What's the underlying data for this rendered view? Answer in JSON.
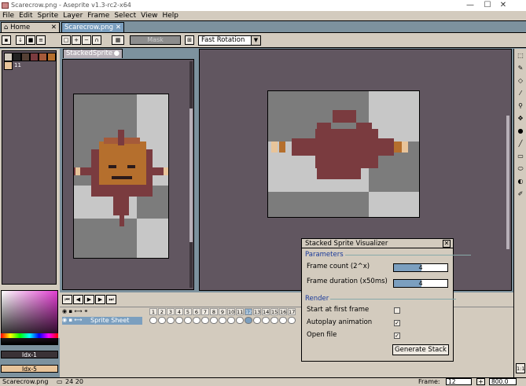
{
  "window": {
    "title": "Scarecrow.png - Aseprite v1.3-rc2-x64",
    "minimize": "—",
    "maximize": "☐",
    "close": "✕"
  },
  "menu": [
    "File",
    "Edit",
    "Sprite",
    "Layer",
    "Frame",
    "Select",
    "View",
    "Help"
  ],
  "tabs": [
    {
      "label": "Home",
      "close": "✕"
    },
    {
      "label": "Scarecrow.png",
      "close": "✕"
    }
  ],
  "toolbar": {
    "mask_label": "Mask",
    "rotation_value": "Fast Rotation",
    "rotation_arrow": "▼"
  },
  "palette": {
    "colors": [
      "#222222",
      "#554035",
      "#7a3b3f",
      "#a55a3a",
      "#b56f2d",
      "#e8c49a"
    ],
    "extra_label": "11"
  },
  "color_picker": {
    "fg_index": "Idx-1",
    "bg_index": "Idx-5"
  },
  "stacked_panel": {
    "label": "StackedSprite",
    "close": "●"
  },
  "timeline": {
    "nav": [
      "⏮",
      "◀",
      "▶",
      "▶",
      "⏭"
    ],
    "layer_name": "Sprite Sheet",
    "frames": [
      "1",
      "2",
      "3",
      "4",
      "5",
      "6",
      "7",
      "8",
      "9",
      "10",
      "11",
      "12",
      "13",
      "14",
      "15",
      "16",
      "17"
    ],
    "active_frame": "12"
  },
  "dialog": {
    "title": "Stacked Sprite Visualizer",
    "close": "✕",
    "params_section": "Parameters",
    "frame_count_label": "Frame count (2^x)",
    "frame_count_value": "4",
    "frame_count_fraction": 0.52,
    "frame_duration_label": "Frame duration (x50ms)",
    "frame_duration_value": "4",
    "frame_duration_fraction": 0.52,
    "render_section": "Render",
    "start_first_label": "Start at first frame",
    "start_first_checked": "",
    "autoplay_label": "Autoplay animation",
    "autoplay_checked": "✓",
    "open_file_label": "Open file",
    "open_file_checked": "✓",
    "generate_label": "Generate Stack"
  },
  "status": {
    "filename": "Scarecrow.png",
    "size": "24 20",
    "frame_label": "Frame:",
    "frame_value": "12",
    "zoom_value": "800.0",
    "plus": "+",
    "ratio": "1:1"
  },
  "colors": {
    "workspace": "#615660",
    "panel": "#d3cbbe",
    "accent": "#7b9fbf",
    "sprite_body": "#7a3b3f"
  }
}
